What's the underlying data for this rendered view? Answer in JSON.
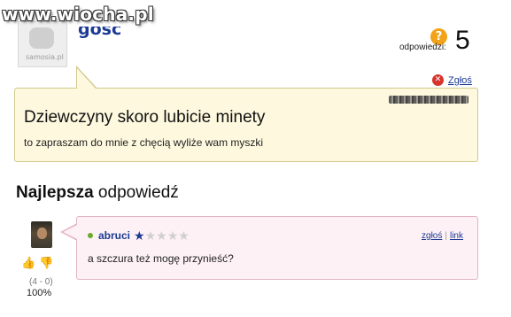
{
  "watermark": "www.wiocha.pl",
  "asker": {
    "avatar_site": "samosia.pl",
    "name": "gość"
  },
  "stats": {
    "answers_label": "odpowiedzi:",
    "answers_count": "5",
    "question_icon": "?"
  },
  "question": {
    "report_label": "Zgłoś",
    "title": "Dziewczyny skoro lubicie minety",
    "body": "to zapraszam do mnie z chęcią wyliże wam myszki"
  },
  "best_answer": {
    "heading_bold": "Najlepsza",
    "heading_rest": " odpowiedź",
    "user": "abruci",
    "rating_stars": 1,
    "rating_max": 5,
    "report_label": "zgłoś",
    "separator": "|",
    "link_label": "link",
    "body": "a szczura też mogę przynieść?",
    "votes": "(4 - 0)",
    "percent": "100%"
  },
  "colors": {
    "link": "#1c3a93",
    "question_bg": "#fdf8de",
    "answer_bg": "#fdf1f5"
  }
}
